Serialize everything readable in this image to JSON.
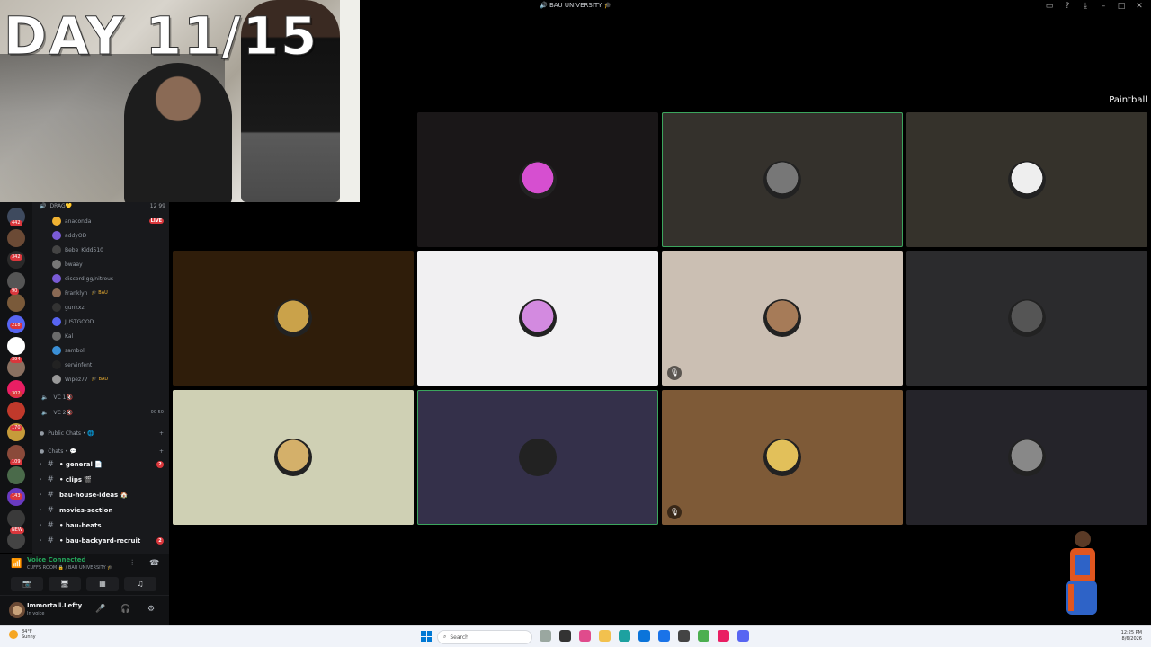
{
  "window": {
    "title": "🔊 BAU UNIVERSITY 🎓"
  },
  "overlay": {
    "day_text": "DAY 11/15"
  },
  "stage": {
    "label": "Paintball",
    "tiles": [
      {
        "bg": "#000000",
        "avatar": "",
        "speaking": false,
        "muted": false
      },
      {
        "bg": "#1a1718",
        "avatar": "#d64fd0",
        "speaking": false,
        "muted": false
      },
      {
        "bg": "#34312c",
        "avatar": "#777777",
        "speaking": true,
        "muted": false
      },
      {
        "bg": "#35322b",
        "avatar": "#eeeeee",
        "speaking": false,
        "muted": false
      },
      {
        "bg": "#2f1d0a",
        "avatar": "#caa24a",
        "speaking": false,
        "muted": false
      },
      {
        "bg": "#f1f0f2",
        "avatar": "#d38ae0",
        "speaking": false,
        "muted": false
      },
      {
        "bg": "#cbbfb3",
        "avatar": "#a67b58",
        "speaking": false,
        "muted": true
      },
      {
        "bg": "#2b2b2d",
        "avatar": "#555555",
        "speaking": false,
        "muted": false
      },
      {
        "bg": "#cfd0b4",
        "avatar": "#d4b06a",
        "speaking": false,
        "muted": false
      },
      {
        "bg": "#34304a",
        "avatar": "#222222",
        "speaking": true,
        "muted": false
      },
      {
        "bg": "#7e5a37",
        "avatar": "#e2c05a",
        "speaking": false,
        "muted": true
      },
      {
        "bg": "#25242a",
        "avatar": "#888888",
        "speaking": false,
        "muted": false
      }
    ]
  },
  "rail": {
    "badges": [
      "442",
      "342",
      "90",
      "218",
      "394",
      "302",
      "170",
      "109",
      "143",
      "NEW"
    ]
  },
  "channels": {
    "current_vc": {
      "name": "DRAG💛",
      "count": "12",
      "limit": "99"
    },
    "members": [
      {
        "name": "anaconda",
        "tag": "",
        "live": "LIVE",
        "color": "#f0b232"
      },
      {
        "name": "addyOD",
        "tag": "",
        "live": "",
        "color": "#7a5bd6"
      },
      {
        "name": "Bebe_Kidd510",
        "tag": "",
        "live": "",
        "color": "#444"
      },
      {
        "name": "bwaay",
        "tag": "",
        "live": "",
        "color": "#777"
      },
      {
        "name": "discord.gg/nitrous",
        "tag": "",
        "live": "",
        "color": "#7a5bd6"
      },
      {
        "name": "Franklyn",
        "tag": "🎓 BAU",
        "live": "",
        "color": "#8a6a55"
      },
      {
        "name": "gunkxz",
        "tag": "",
        "live": "",
        "color": "#333"
      },
      {
        "name": "JUSTGOOD",
        "tag": "",
        "live": "",
        "color": "#5865f2"
      },
      {
        "name": "Kal",
        "tag": "",
        "live": "",
        "color": "#6b6b6b"
      },
      {
        "name": "sambol",
        "tag": "",
        "live": "",
        "color": "#3a8fd6"
      },
      {
        "name": "servinfent",
        "tag": "",
        "live": "",
        "color": "#222"
      },
      {
        "name": "Wipez77",
        "tag": "🎓 BAU",
        "live": "",
        "color": "#999"
      }
    ],
    "voice_channels": [
      {
        "name": "VC 1🔇",
        "count": "",
        "limit": ""
      },
      {
        "name": "VC 2🔇",
        "count": "00",
        "limit": "50"
      }
    ],
    "categories": [
      {
        "name": "Public Chats • 🌐"
      },
      {
        "name": "Chats • 💬"
      }
    ],
    "text_channels": [
      {
        "name": "• general 📄",
        "unread": "2"
      },
      {
        "name": "• clips 🎬",
        "unread": ""
      },
      {
        "name": "bau-house-ideas 🏠",
        "unread": ""
      },
      {
        "name": "movies-section",
        "unread": ""
      },
      {
        "name": "• bau-beats",
        "unread": ""
      },
      {
        "name": "• bau-backyard-recruit",
        "unread": "2"
      }
    ]
  },
  "voice": {
    "status": "Voice Connected",
    "room": "CUFFS ROOM 🔒 / BAU UNIVERSITY 🎓"
  },
  "user": {
    "name": "Immortall.Lefty",
    "status": "In voice"
  },
  "taskbar": {
    "weather_temp": "84°F",
    "weather_desc": "Sunny",
    "search_placeholder": "Search",
    "time": "12:25 PM",
    "date": "8/6/2026"
  },
  "colors": {
    "speaking": "#3ba55d",
    "unread": "#da373c",
    "voice_connected": "#23a55a"
  }
}
